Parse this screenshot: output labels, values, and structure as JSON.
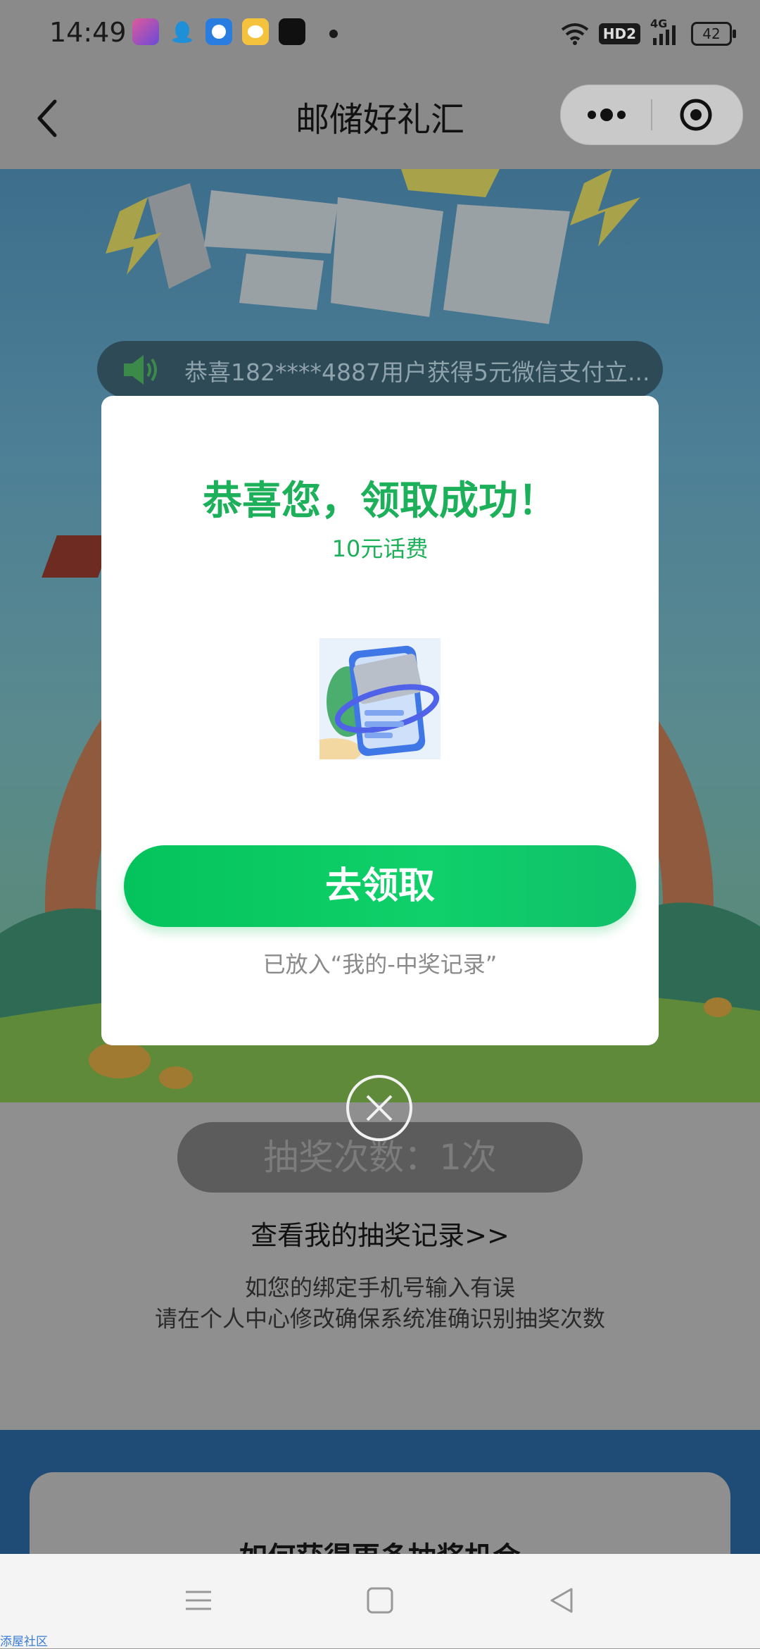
{
  "status_bar": {
    "time": "14:49",
    "network": "4G",
    "hd": "HD2",
    "battery": "42"
  },
  "nav": {
    "title": "邮储好礼汇"
  },
  "banner": {
    "ticker": "恭喜182****4887用户获得5元微信支付立..."
  },
  "page": {
    "draw_count": "抽奖次数：1次",
    "records_link": "查看我的抽奖记录>>",
    "hint_line1": "如您的绑定手机号输入有误",
    "hint_line2": "请在个人中心修改确保系统准确识别抽奖次数",
    "more_chances": "·如何获得更多抽奖机会·"
  },
  "modal": {
    "title": "恭喜您，领取成功！",
    "prize": "10元话费",
    "claim_button": "去领取",
    "note": "已放入“我的-中奖记录”"
  },
  "watermark": "添屋社区",
  "colors": {
    "accent_green": "#1db05a",
    "button_green": "#05c35c",
    "dim_overlay": "#8a8a8a"
  }
}
